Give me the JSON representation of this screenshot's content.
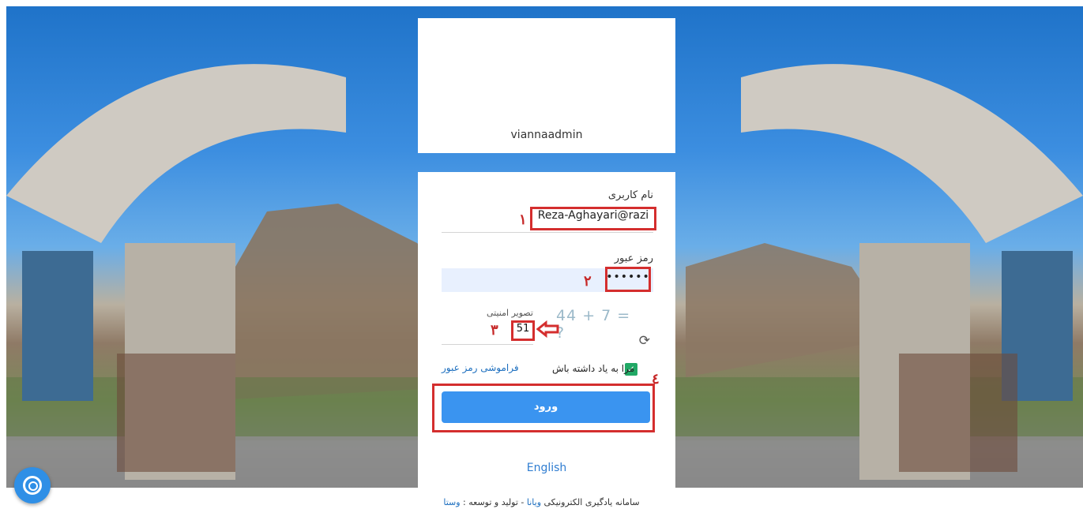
{
  "card": {
    "username_display": "viannaadmin",
    "username_label": "نام کاربری",
    "username_value": "Reza-Aghayari@razi",
    "password_label": "رمز عبور",
    "password_value": "••••••",
    "captcha_label": "تصویر امنیتی",
    "captcha_question": "44 + 7 = ?",
    "captcha_value": "51",
    "remember_label": "مرا به یاد داشته باش",
    "forgot_label": "فراموشی رمز عبور",
    "login_label": "ورود",
    "language_link": "English"
  },
  "annotations": {
    "step1": "۱",
    "step2": "۲",
    "step3": "۳",
    "step4": "٤"
  },
  "footer": {
    "prefix": "سامانه یادگیری الکترونیکی",
    "brand": "ویانا",
    "middle": "- تولید و توسعه :",
    "developer": "وستا"
  }
}
